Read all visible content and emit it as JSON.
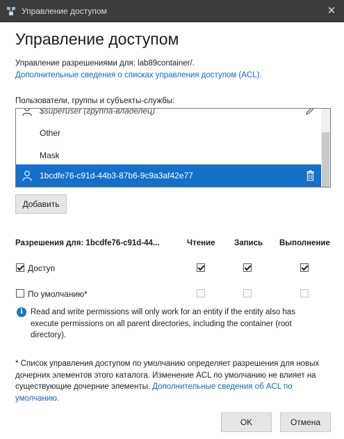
{
  "window": {
    "title": "Управление доступом",
    "close_glyph": "✕"
  },
  "header": {
    "heading": "Управление доступом",
    "subtitle": "Управление разрешениями для: lab89container/.",
    "acl_link": "Дополнительные сведения о списках управления доступом (ACL)."
  },
  "users": {
    "label": "Пользователи, группы и субъекты-службы:",
    "items": [
      {
        "name": "$superuser (группа-владелец)",
        "icon": "group-icon",
        "partial": true
      },
      {
        "name": "Other",
        "icon": null
      },
      {
        "name": "Mask",
        "icon": null
      },
      {
        "name": "1bcdfe76-c91d-44b3-87b6-9c9a3af42e77",
        "icon": "user-icon",
        "selected": true
      }
    ],
    "add_button": "Добавить"
  },
  "permissions": {
    "header_label": "Разрешения для: 1bcdfe76-c91d-44...",
    "columns": [
      "Чтение",
      "Запись",
      "Выполнение"
    ],
    "rows": [
      {
        "label": "Доступ",
        "enabled": true,
        "checked": true,
        "values": [
          true,
          true,
          true
        ]
      },
      {
        "label": "По умолчанию*",
        "enabled": false,
        "checked": false,
        "values": [
          false,
          false,
          false
        ]
      }
    ]
  },
  "info": {
    "text": "Read and write permissions will only work for an entity if the entity also has execute permissions on all parent directories, including the container (root directory)."
  },
  "footnote": {
    "text": "* Список управления доступом по умолчанию определяет разрешения для новых дочерних элементов этого каталога. Изменение ACL по умолчанию не влияет на существующие дочерние элементы. ",
    "link": "Дополнительные сведения об ACL по умолчанию."
  },
  "buttons": {
    "ok": "OK",
    "cancel": "Отмена"
  },
  "colors": {
    "selected_row": "#1470c9",
    "link": "#1a63b8",
    "titlebar": "#3c3c3c"
  }
}
